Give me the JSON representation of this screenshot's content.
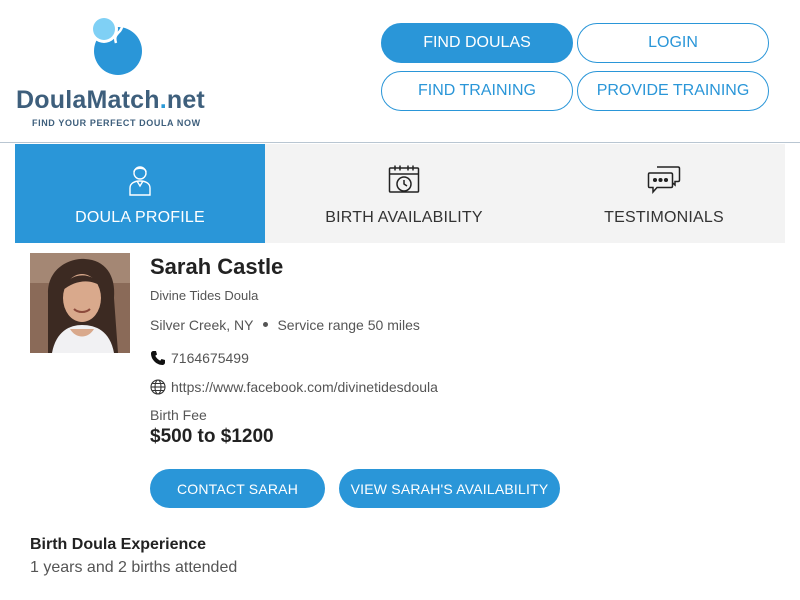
{
  "header": {
    "logo": {
      "name_main": "DoulaMatch",
      "name_dot": ".",
      "name_tld": "net",
      "tagline": "FIND YOUR PERFECT DOULA NOW"
    },
    "nav": {
      "find_doulas": "FIND DOULAS",
      "login": "LOGIN",
      "find_training": "FIND TRAINING",
      "provide_training": "PROVIDE TRAINING"
    }
  },
  "tabs": [
    {
      "label": "DOULA PROFILE",
      "icon": "person-icon",
      "active": true
    },
    {
      "label": "BIRTH AVAILABILITY",
      "icon": "calendar-clock-icon",
      "active": false
    },
    {
      "label": "TESTIMONIALS",
      "icon": "chat-bubbles-icon",
      "active": false
    }
  ],
  "profile": {
    "name": "Sarah Castle",
    "business": "Divine Tides Doula",
    "location": "Silver Creek, NY",
    "service_range": "Service range 50 miles",
    "phone": "7164675499",
    "website": "https://www.facebook.com/divinetidesdoula",
    "fee_label": "Birth Fee",
    "fee_value": "$500 to $1200",
    "contact_button": "CONTACT SARAH",
    "availability_button": "VIEW SARAH'S AVAILABILITY"
  },
  "experience": {
    "title": "Birth Doula Experience",
    "value": "1 years and 2 births attended"
  },
  "colors": {
    "brand_blue": "#2a96d8",
    "logo_navy": "#3e5f7c",
    "tab_bg": "#f3f3f3"
  }
}
